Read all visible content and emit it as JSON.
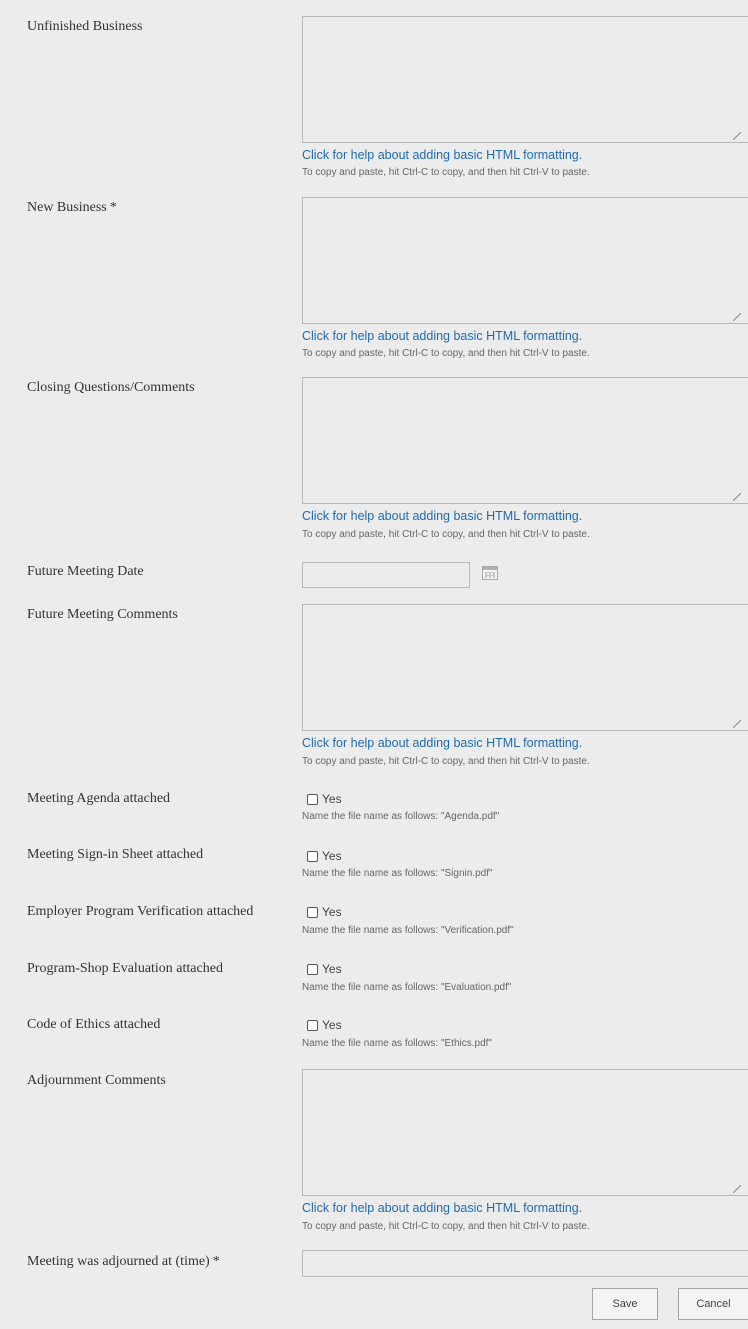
{
  "help_link_text": "Click for help about adding basic HTML formatting.",
  "paste_hint_text": "To copy and paste, hit Ctrl-C to copy, and then hit Ctrl-V to paste.",
  "required_marker": "*",
  "fields": {
    "unfinished_business": {
      "label": "Unfinished Business",
      "value": ""
    },
    "new_business": {
      "label": "New Business",
      "value": ""
    },
    "closing_questions": {
      "label": "Closing Questions/Comments",
      "value": ""
    },
    "future_meeting_date": {
      "label": "Future Meeting Date",
      "value": ""
    },
    "future_meeting_comments": {
      "label": "Future Meeting Comments",
      "value": ""
    },
    "adjournment_comments": {
      "label": "Adjournment Comments",
      "value": ""
    },
    "adjourned_time": {
      "label": "Meeting was adjourned at (time)",
      "value": ""
    }
  },
  "checkboxes": [
    {
      "label": "Meeting Agenda attached",
      "option": "Yes",
      "checked": false,
      "hint": "Name the file name as follows: \"Agenda.pdf\""
    },
    {
      "label": "Meeting Sign-in Sheet attached",
      "option": "Yes",
      "checked": false,
      "hint": "Name the file name as follows: \"Signin.pdf\""
    },
    {
      "label": "Employer Program Verification attached",
      "option": "Yes",
      "checked": false,
      "hint": "Name the file name as follows: \"Verification.pdf\""
    },
    {
      "label": "Program-Shop Evaluation attached",
      "option": "Yes",
      "checked": false,
      "hint": "Name the file name as follows: \"Evaluation.pdf\""
    },
    {
      "label": "Code of Ethics attached",
      "option": "Yes",
      "checked": false,
      "hint": "Name the file name as follows: \"Ethics.pdf\""
    }
  ],
  "buttons": {
    "save": "Save",
    "cancel": "Cancel"
  }
}
